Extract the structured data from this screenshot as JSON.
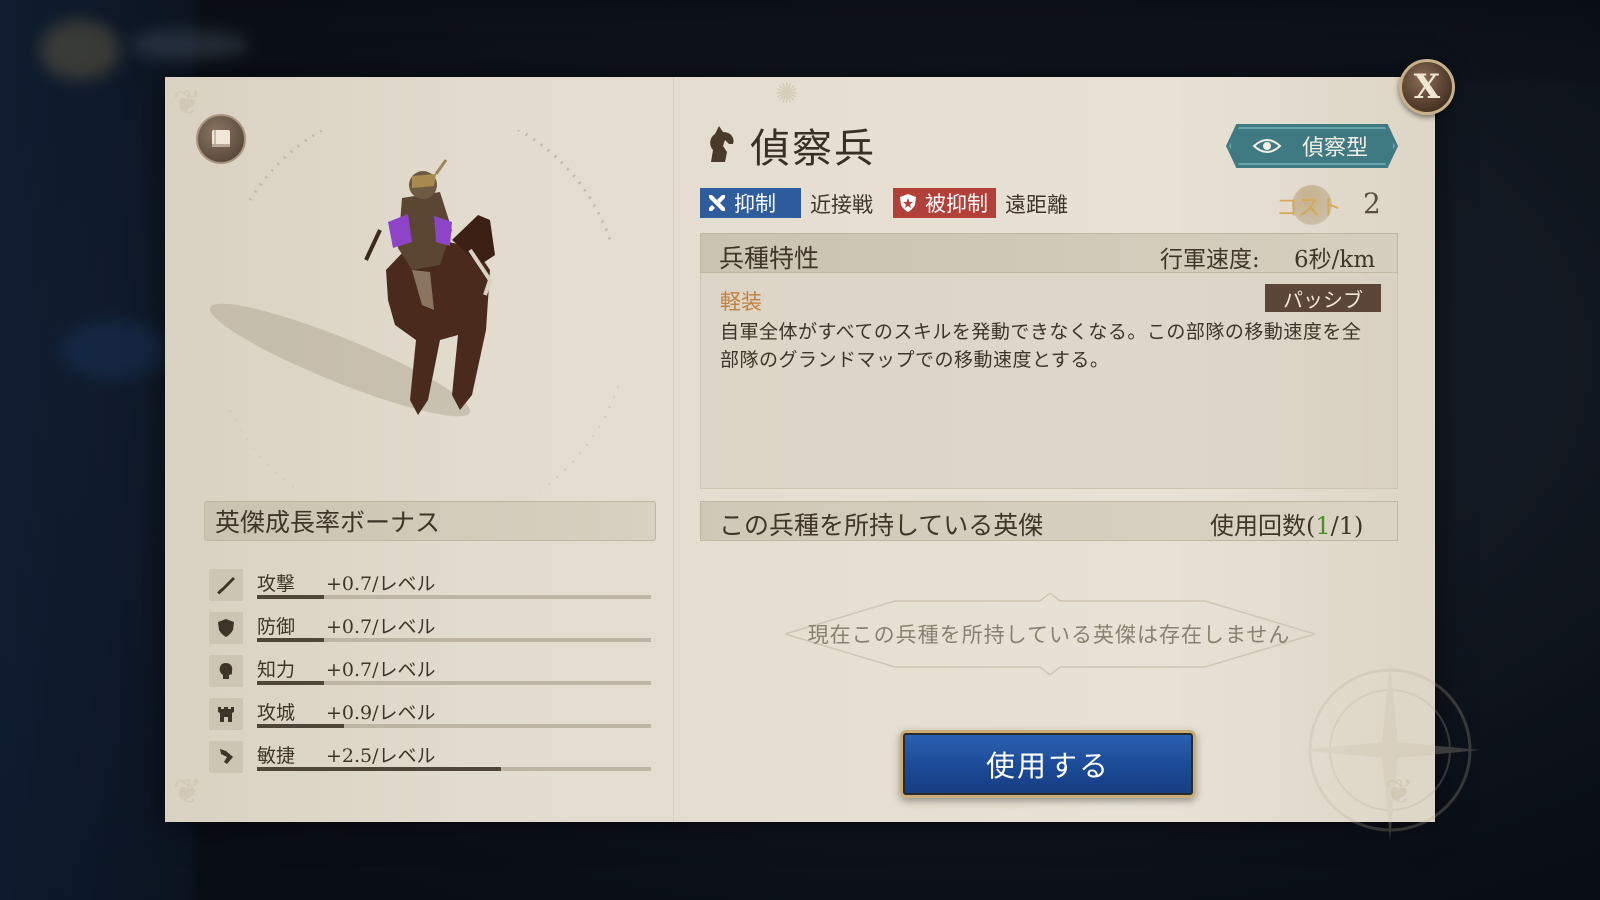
{
  "window": {
    "close_label": "X"
  },
  "unit": {
    "name": "偵察兵",
    "type_tag": "偵察型",
    "suppress_label": "抑制",
    "suppress_target": "近接戦",
    "suppressed_label": "被抑制",
    "suppressed_target": "遠距離",
    "cost_label": "コスト",
    "cost_value": "2"
  },
  "traits": {
    "title": "兵種特性",
    "march_speed_label": "行軍速度:",
    "march_speed_value": "6秒/km",
    "skill": {
      "name": "軽装",
      "tag": "パッシブ",
      "description": "自軍全体がすべてのスキルを発動できなくなる。この部隊の移動速度を全部隊のグランドマップでの移動速度とする。"
    }
  },
  "growth": {
    "title": "英傑成長率ボーナス",
    "stats": [
      {
        "label": "攻撃",
        "value": "+0.7/レベル",
        "icon": "sword-icon",
        "fill": 0.17
      },
      {
        "label": "防御",
        "value": "+0.7/レベル",
        "icon": "shield-icon",
        "fill": 0.17
      },
      {
        "label": "知力",
        "value": "+0.7/レベル",
        "icon": "head-icon",
        "fill": 0.17
      },
      {
        "label": "攻城",
        "value": "+0.9/レベル",
        "icon": "tower-icon",
        "fill": 0.22
      },
      {
        "label": "敏捷",
        "value": "+2.5/レベル",
        "icon": "boot-icon",
        "fill": 0.62
      }
    ]
  },
  "heroes": {
    "title": "この兵種を所持している英傑",
    "usage_label": "使用回数",
    "usage_open": "(",
    "usage_current": "1",
    "usage_sep": "/",
    "usage_total": "1",
    "usage_close": ")",
    "empty_message": "現在この兵種を所持している英傑は存在しません"
  },
  "actions": {
    "use_label": "使用する"
  },
  "colors": {
    "suppress": "#2f5c9c",
    "suppressed": "#b34038",
    "scout_tag": "#3f7a82",
    "skill_name": "#c0813f",
    "cost_label": "#d4aa52",
    "usage_current": "#4f8a2d",
    "use_button": "#1b4a96"
  }
}
